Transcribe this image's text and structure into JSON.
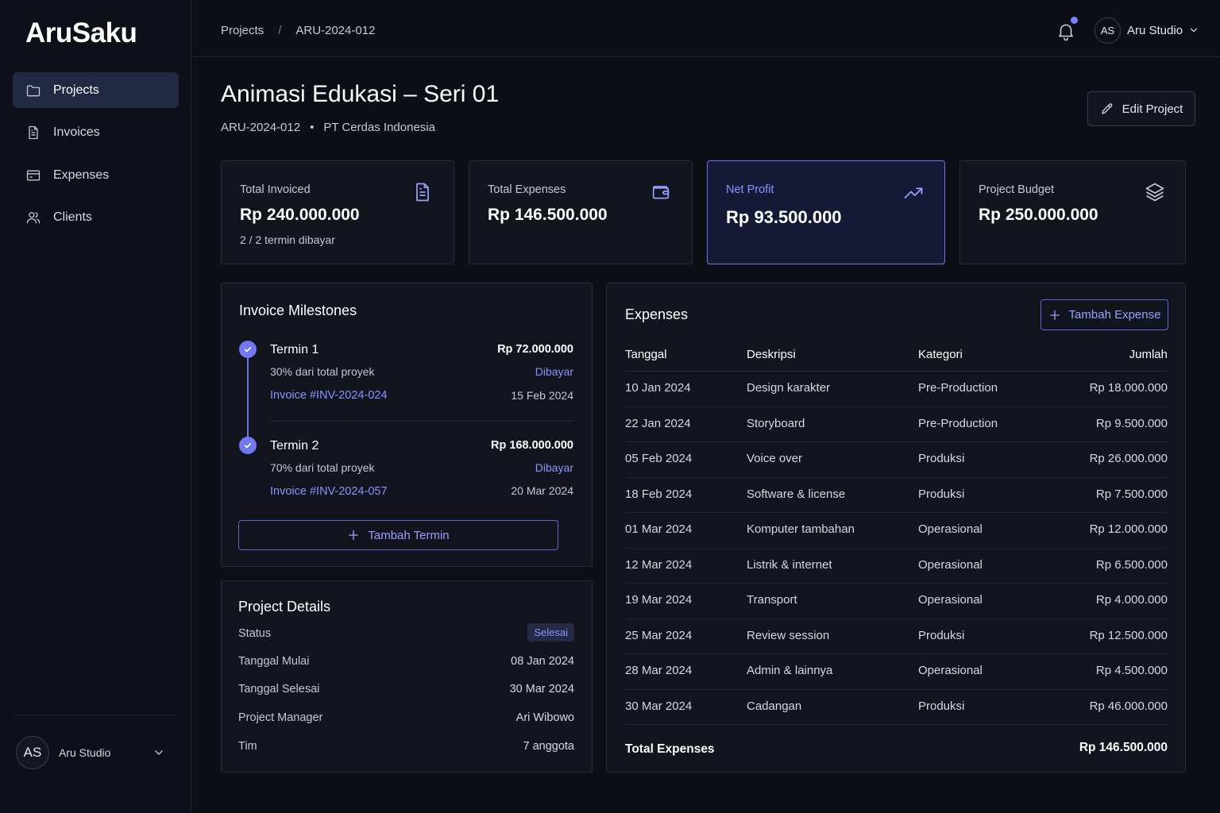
{
  "app": {
    "logo": "AruSaku"
  },
  "sidebar": {
    "items": [
      {
        "label": "Projects",
        "icon": "folder-icon",
        "active": true
      },
      {
        "label": "Invoices",
        "icon": "document-icon",
        "active": false
      },
      {
        "label": "Expenses",
        "icon": "card-icon",
        "active": false
      },
      {
        "label": "Clients",
        "icon": "users-icon",
        "active": false
      }
    ],
    "user": {
      "initials": "AS",
      "name": "Aru Studio"
    }
  },
  "topbar": {
    "breadcrumb": [
      "Projects",
      "ARU-2024-012"
    ],
    "breadcrumb_sep": "/",
    "user": {
      "initials": "AS",
      "name": "Aru Studio"
    },
    "accent": "#7b83ff"
  },
  "project": {
    "title": "Animasi Edukasi – Seri 01",
    "code": "ARU-2024-012",
    "separator": "•",
    "client": "PT Cerdas Indonesia",
    "edit_label": "Edit Project"
  },
  "stats": [
    {
      "label": "Total Invoiced",
      "value": "Rp 240.000.000",
      "sub": "2 / 2 termin dibayar",
      "icon": "document-icon"
    },
    {
      "label": "Total Expenses",
      "value": "Rp 146.500.000",
      "sub": "",
      "icon": "wallet-icon"
    },
    {
      "label": "Net Profit",
      "value": "Rp 93.500.000",
      "sub": "",
      "icon": "trend-up-icon"
    },
    {
      "label": "Project Budget",
      "value": "Rp 250.000.000",
      "sub": "",
      "icon": "layers-icon"
    }
  ],
  "milestones": {
    "title": "Invoice Milestones",
    "items": [
      {
        "name": "Termin 1",
        "desc": "30% dari total proyek",
        "invoice": "Invoice #INV-2024-024",
        "amount": "Rp 72.000.000",
        "status": "Dibayar",
        "date": "15 Feb 2024"
      },
      {
        "name": "Termin 2",
        "desc": "70% dari total proyek",
        "invoice": "Invoice #INV-2024-057",
        "amount": "Rp 168.000.000",
        "status": "Dibayar",
        "date": "20 Mar 2024"
      }
    ],
    "add_label": "Tambah Termin"
  },
  "details": {
    "title": "Project Details",
    "status_label": "Status",
    "status_value": "Selesai",
    "rows": [
      {
        "label": "Tanggal Mulai",
        "value": "08 Jan 2024"
      },
      {
        "label": "Tanggal Selesai",
        "value": "30 Mar 2024"
      },
      {
        "label": "Project Manager",
        "value": "Ari Wibowo"
      },
      {
        "label": "Tim",
        "value": "7 anggota"
      }
    ]
  },
  "expenses": {
    "title": "Expenses",
    "add_label": "Tambah Expense",
    "columns": [
      "Tanggal",
      "Deskripsi",
      "Kategori",
      "Jumlah"
    ],
    "rows": [
      [
        "10 Jan 2024",
        "Design karakter",
        "Pre-Production",
        "Rp 18.000.000"
      ],
      [
        "22 Jan 2024",
        "Storyboard",
        "Pre-Production",
        "Rp 9.500.000"
      ],
      [
        "05 Feb 2024",
        "Voice over",
        "Produksi",
        "Rp 26.000.000"
      ],
      [
        "18 Feb 2024",
        "Software & license",
        "Produksi",
        "Rp 7.500.000"
      ],
      [
        "01 Mar 2024",
        "Komputer tambahan",
        "Operasional",
        "Rp 12.000.000"
      ],
      [
        "12 Mar 2024",
        "Listrik & internet",
        "Operasional",
        "Rp 6.500.000"
      ],
      [
        "19 Mar 2024",
        "Transport",
        "Operasional",
        "Rp 4.000.000"
      ],
      [
        "25 Mar 2024",
        "Review session",
        "Produksi",
        "Rp 12.500.000"
      ],
      [
        "28 Mar 2024",
        "Admin & lainnya",
        "Operasional",
        "Rp 4.500.000"
      ],
      [
        "30 Mar 2024",
        "Cadangan",
        "Produksi",
        "Rp 46.000.000"
      ]
    ],
    "total_label": "Total Expenses",
    "total_value": "Rp 146.500.000"
  }
}
